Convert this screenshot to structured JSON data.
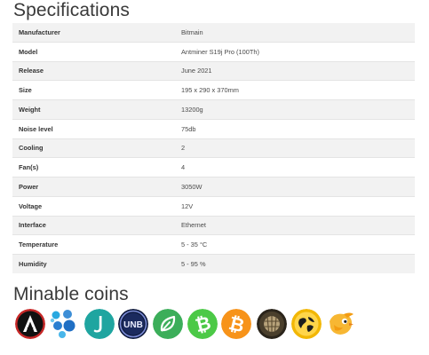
{
  "specifications": {
    "title": "Specifications",
    "rows": [
      {
        "label": "Manufacturer",
        "value": "Bitmain"
      },
      {
        "label": "Model",
        "value": "Antminer S19j Pro (100Th)"
      },
      {
        "label": "Release",
        "value": "June 2021"
      },
      {
        "label": "Size",
        "value": "195 x 290 x 370mm"
      },
      {
        "label": "Weight",
        "value": "13200g"
      },
      {
        "label": "Noise level",
        "value": "75db"
      },
      {
        "label": "Cooling",
        "value": "2"
      },
      {
        "label": "Fan(s)",
        "value": "4"
      },
      {
        "label": "Power",
        "value": "3050W"
      },
      {
        "label": "Voltage",
        "value": "12V"
      },
      {
        "label": "Interface",
        "value": "Ethernet"
      },
      {
        "label": "Temperature",
        "value": "5 - 35 °C"
      },
      {
        "label": "Humidity",
        "value": "5 - 95 %"
      }
    ]
  },
  "minable_coins": {
    "title": "Minable coins",
    "icons": [
      {
        "name": "acoin-icon",
        "color": "#111111"
      },
      {
        "name": "dots-coin-icon",
        "color": "#2d8fd5"
      },
      {
        "name": "j-coin-icon",
        "color": "#1fa5a0"
      },
      {
        "name": "unb-coin-icon",
        "color": "#1b2a5e",
        "text": "UNB"
      },
      {
        "name": "leaf-coin-icon",
        "color": "#3cae5a"
      },
      {
        "name": "bitcoin-cash-icon",
        "color": "#4cc947"
      },
      {
        "name": "bitcoin-icon",
        "color": "#f7931a"
      },
      {
        "name": "shell-coin-icon",
        "color": "#3a3326"
      },
      {
        "name": "globe-coin-icon",
        "color": "#f2b705"
      },
      {
        "name": "bird-coin-icon",
        "color": "#f7b733"
      }
    ]
  }
}
